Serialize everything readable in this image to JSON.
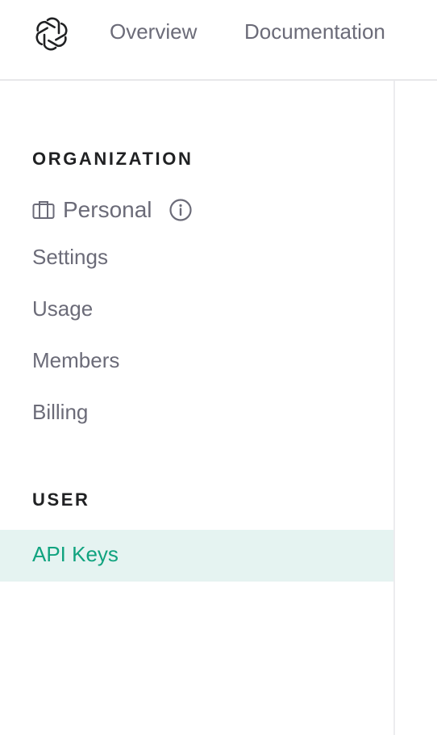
{
  "header": {
    "logo_icon": "openai-logo-icon",
    "nav": [
      {
        "label": "Overview"
      },
      {
        "label": "Documentation"
      }
    ]
  },
  "sidebar": {
    "organization": {
      "title": "ORGANIZATION",
      "current": {
        "icon": "briefcase-icon",
        "name": "Personal",
        "info_icon": "info-icon"
      },
      "items": [
        {
          "label": "Settings"
        },
        {
          "label": "Usage"
        },
        {
          "label": "Members"
        },
        {
          "label": "Billing"
        }
      ]
    },
    "user": {
      "title": "USER",
      "items": [
        {
          "label": "API Keys",
          "active": true
        }
      ]
    }
  },
  "colors": {
    "text": "#6b6b78",
    "heading": "#202123",
    "accent": "#10a37f",
    "active_bg": "#e5f3f1",
    "divider": "#e7e7ea"
  }
}
